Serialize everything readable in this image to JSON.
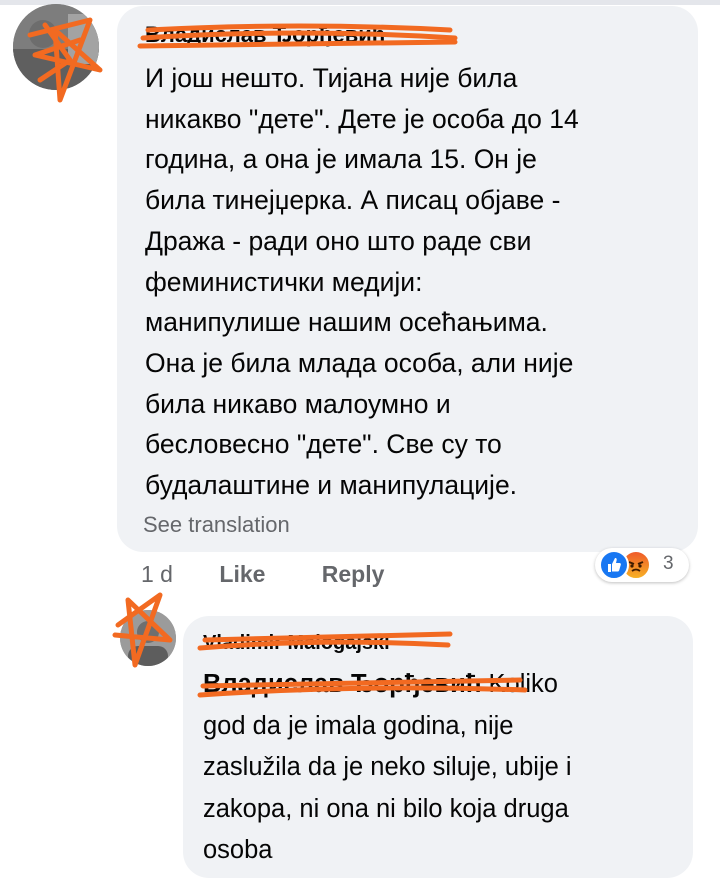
{
  "comment": {
    "author": "Владислав Ђорђевић",
    "text": "И још нешто. Тијана није била\nникакво \"дете\". Дете је особа до 14\nгодина, а она је имала 15. Он је\nбила тинејџерка. А писац објаве -\nДража - ради оно што раде сви\nфеминистички медији:\nманипулише нашим осећањима.\nОна је била млада особа, али није\nбила никаво малоумно и\nбесловесно \"дете\". Све су то\nбудалаштине и манипулације.",
    "see_translation": "See translation",
    "time": "1 d",
    "like_label": "Like",
    "reply_label": "Reply",
    "reaction_count": "3",
    "reaction_icons": [
      "like-icon",
      "angry-icon"
    ]
  },
  "reply": {
    "author": "Vladimir Malogajski",
    "mention": "Владислав Ђорђевић",
    "text": "Koliko\ngod da je imala godina, nije\nzaslužila da je neko siluje, ubije i\nzakopa, ni ona ni bilo koja druga\nosoba"
  },
  "colors": {
    "bubble": "#f0f2f5",
    "secondary_text": "#65676b",
    "like_blue": "#1877f2",
    "redaction_orange": "#f26a21"
  }
}
